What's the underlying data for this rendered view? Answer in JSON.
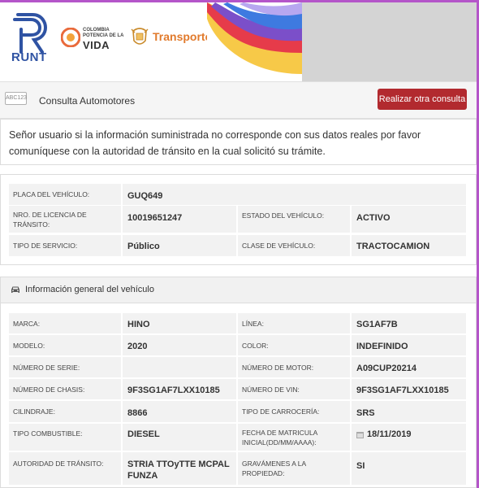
{
  "header": {
    "runt_label": "RUNT",
    "colombia_line1": "COLOMBIA",
    "colombia_line2": "POTENCIA DE LA",
    "colombia_line3": "VIDA",
    "transporte_label": "Transporte"
  },
  "toolbar": {
    "badge": "ABC123",
    "title": "Consulta Automotores",
    "action_label": "Realizar otra consulta"
  },
  "notice": {
    "text": "Señor usuario si la información suministrada no corresponde con sus datos reales por favor comuníquese con la autoridad de tránsito en la cual solicitó su trámite."
  },
  "summary": {
    "placa_label": "PLACA DEL VEHÍCULO:",
    "placa_value": "GUQ649",
    "licencia_label_1": "NRO. DE LICENCIA DE",
    "licencia_label_2": "TRÁNSITO:",
    "licencia_value": "10019651247",
    "estado_label": "ESTADO DEL VEHÍCULO:",
    "estado_value": "ACTIVO",
    "servicio_label": "TIPO DE SERVICIO:",
    "servicio_value": "Público",
    "clase_label": "CLASE DE VEHÍCULO:",
    "clase_value": "TRACTOCAMION"
  },
  "general": {
    "title": "Información general del vehículo",
    "marca_label": "MARCA:",
    "marca_value": "HINO",
    "linea_label": "LÍNEA:",
    "linea_value": "SG1AF7B",
    "modelo_label": "MODELO:",
    "modelo_value": "2020",
    "color_label": "COLOR:",
    "color_value": "INDEFINIDO",
    "serie_label": "NÚMERO DE SERIE:",
    "serie_value": "",
    "motor_label": "NÚMERO DE MOTOR:",
    "motor_value": "A09CUP20214",
    "chasis_label": "NÚMERO DE CHASIS:",
    "chasis_value": "9F3SG1AF7LXX10185",
    "vin_label": "NÚMERO DE VIN:",
    "vin_value": "9F3SG1AF7LXX10185",
    "cilindraje_label": "CILINDRAJE:",
    "cilindraje_value": "8866",
    "carroceria_label": "TIPO DE CARROCERÍA:",
    "carroceria_value": "SRS",
    "combustible_label": "TIPO COMBUSTIBLE:",
    "combustible_value": "DIESEL",
    "matricula_label_1": "FECHA DE MATRICULA",
    "matricula_label_2": "INICIAL(DD/MM/AAAA):",
    "matricula_value": "18/11/2019",
    "autoridad_label": "AUTORIDAD DE TRÁNSITO:",
    "autoridad_value_1": "STRIA TTOyTTE MCPAL",
    "autoridad_value_2": "FUNZA",
    "gravamenes_label_1": "GRAVÁMENES A LA",
    "gravamenes_label_2": "PROPIEDAD:",
    "gravamenes_value": "SI"
  },
  "colors": {
    "accent_purple": "#b455c9",
    "button_red": "#b22a2f",
    "runt_blue": "#2f53a3",
    "transporte_orange": "#e17a2c"
  }
}
